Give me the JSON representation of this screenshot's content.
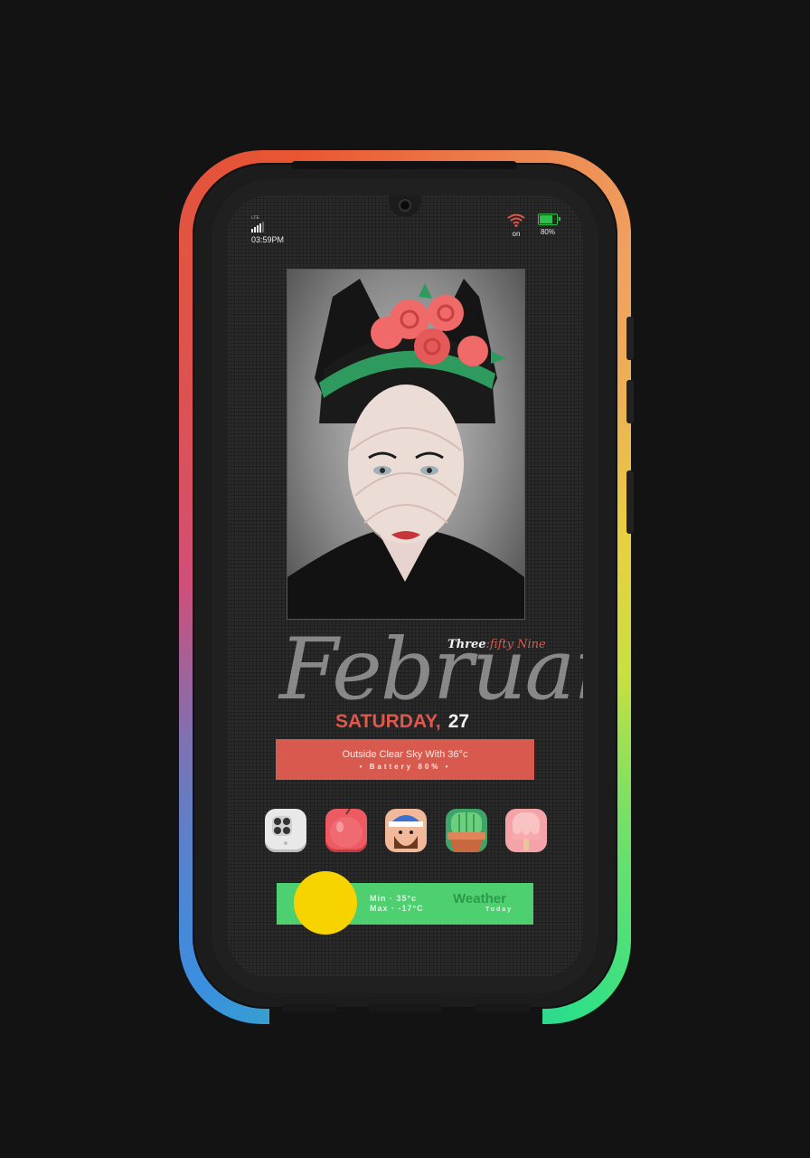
{
  "status_bar": {
    "network_label": "LTE",
    "time": "03:59PM",
    "wifi_label": "on",
    "battery_label": "80%",
    "battery_level": 0.8
  },
  "clock": {
    "time_words_first": "Three",
    "time_words_rest": ":fifty Nine",
    "month": "February",
    "day_name": "SATURDAY,",
    "day_number": "27"
  },
  "info_bar": {
    "line1": "Outside Clear Sky With 36°c",
    "line2": "• Battery 80% •"
  },
  "dock": {
    "icons": [
      "camera-app-icon",
      "apple-icon",
      "bearded-man-icon",
      "cactus-icon",
      "ice-cream-icon"
    ]
  },
  "weather": {
    "min_line": "Min  · 35°c",
    "max_line": "Max · -17°C",
    "title": "Weather",
    "subtitle": "Today"
  },
  "colors": {
    "accent_red": "#d85a4e",
    "weather_green": "#4fd070",
    "sun_yellow": "#f7d300"
  }
}
